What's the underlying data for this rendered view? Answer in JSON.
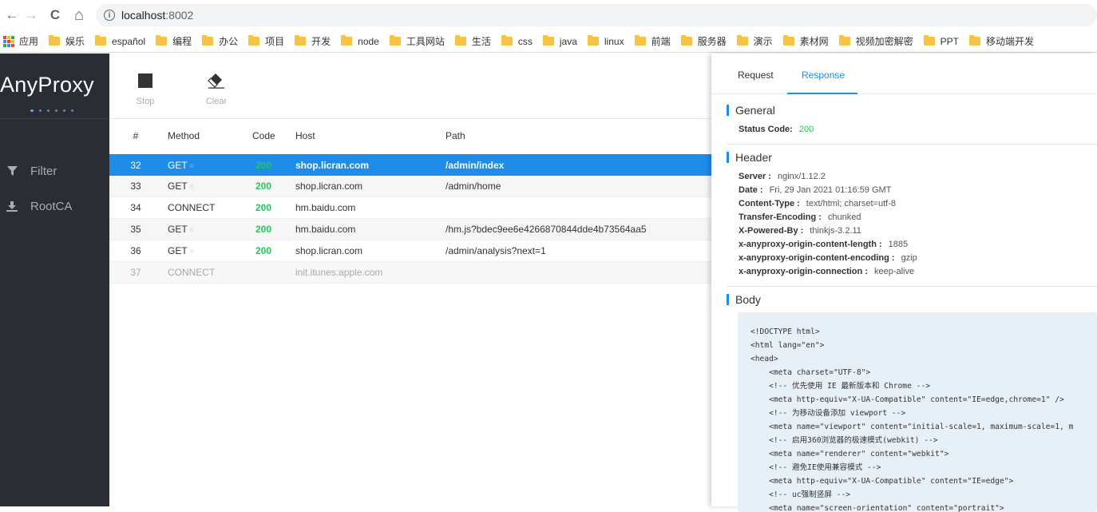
{
  "browser": {
    "back": "←",
    "forward": "→",
    "reload": "C",
    "home": "⌂",
    "info": "i",
    "url_host": "localhost",
    "url_port": ":8002",
    "bookmarks": [
      "应用",
      "娱乐",
      "español",
      "编程",
      "办公",
      "项目",
      "开发",
      "node",
      "工具网站",
      "生活",
      "css",
      "java",
      "linux",
      "前端",
      "服务器",
      "演示",
      "素材网",
      "视频加密解密",
      "PPT",
      "移动端开发"
    ]
  },
  "sidebar": {
    "brand": "AnyProxy",
    "items": [
      {
        "label": "Filter",
        "icon": "filter-icon"
      },
      {
        "label": "RootCA",
        "icon": "download-icon"
      }
    ]
  },
  "toolbar": {
    "stop_label": "Stop",
    "clear_label": "Clear"
  },
  "table": {
    "columns": [
      "#",
      "Method",
      "Code",
      "Host",
      "Path"
    ],
    "rows": [
      {
        "id": "32",
        "method": "GET",
        "secure": true,
        "code": "200",
        "host": "shop.licran.com",
        "path": "/admin/index",
        "state": "selected"
      },
      {
        "id": "33",
        "method": "GET",
        "secure": true,
        "code": "200",
        "host": "shop.licran.com",
        "path": "/admin/home",
        "state": "striped"
      },
      {
        "id": "34",
        "method": "CONNECT",
        "secure": false,
        "code": "200",
        "host": "hm.baidu.com",
        "path": "",
        "state": "normal"
      },
      {
        "id": "35",
        "method": "GET",
        "secure": true,
        "code": "200",
        "host": "hm.baidu.com",
        "path": "/hm.js?bdec9ee6e4266870844dde4b73564aa5",
        "state": "striped"
      },
      {
        "id": "36",
        "method": "GET",
        "secure": true,
        "code": "200",
        "host": "shop.licran.com",
        "path": "/admin/analysis?next=1",
        "state": "normal"
      },
      {
        "id": "37",
        "method": "CONNECT",
        "secure": false,
        "code": "",
        "host": "init.itunes.apple.com",
        "path": "",
        "state": "dim"
      }
    ]
  },
  "panel": {
    "tabs": [
      "Request",
      "Response"
    ],
    "active_tab": "Response",
    "general_title": "General",
    "status_label": "Status Code:",
    "status_value": "200",
    "header_title": "Header",
    "headers": [
      {
        "k": "Server :",
        "v": "nginx/1.12.2"
      },
      {
        "k": "Date :",
        "v": "Fri, 29 Jan 2021 01:16:59 GMT"
      },
      {
        "k": "Content-Type :",
        "v": "text/html; charset=utf-8"
      },
      {
        "k": "Transfer-Encoding :",
        "v": "chunked"
      },
      {
        "k": "X-Powered-By :",
        "v": "thinkjs-3.2.11"
      },
      {
        "k": "x-anyproxy-origin-content-length :",
        "v": "1885"
      },
      {
        "k": "x-anyproxy-origin-content-encoding :",
        "v": "gzip"
      },
      {
        "k": "x-anyproxy-origin-connection :",
        "v": "keep-alive"
      }
    ],
    "body_title": "Body",
    "body_lines": [
      "<!DOCTYPE html>",
      "<html lang=\"en\">",
      "<head>",
      "    <meta charset=\"UTF-8\">",
      "    <!-- 优先使用 IE 最新版本和 Chrome -->",
      "    <meta http-equiv=\"X-UA-Compatible\" content=\"IE=edge,chrome=1\" />",
      "    <!-- 为移动设备添加 viewport -->",
      "    <meta name=\"viewport\" content=\"initial-scale=1, maximum-scale=1, m",
      "    <!-- 启用360浏览器的极速模式(webkit) -->",
      "    <meta name=\"renderer\" content=\"webkit\">",
      "    <!-- 避免IE使用兼容模式 -->",
      "    <meta http-equiv=\"X-UA-Compatible\" content=\"IE=edge\">",
      "    <!-- uc强制竖屏 -->",
      "    <meta name=\"screen-orientation\" content=\"portrait\">"
    ]
  }
}
